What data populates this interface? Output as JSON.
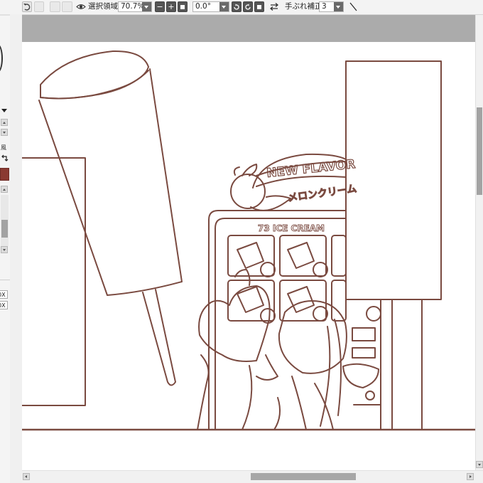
{
  "toolbar": {
    "selection_label": "選択領域",
    "zoom_value": "70.7%",
    "rotation_value": "0.0°",
    "stabilization_label": "手ぶれ補正",
    "stabilization_value": "3"
  },
  "left_panel": {
    "label_char": "風",
    "px_field_1": "0X",
    "px_field_2": "0X"
  },
  "canvas": {
    "sign_top_text": "NEW FLAVOR",
    "sign_sub_text": "メロンクリーム",
    "machine_label": "73 ICE CREAM"
  },
  "colors": {
    "line_art": "#7a4a40",
    "brush_color": "#8a3a32",
    "gray_backdrop": "#ababab"
  },
  "icons": [
    "undo-icon",
    "eye-icon",
    "minus-icon",
    "plus-icon",
    "rotate-left-icon",
    "rotate-right-icon",
    "reset-icon",
    "flip-icon",
    "line-tool-icon"
  ]
}
